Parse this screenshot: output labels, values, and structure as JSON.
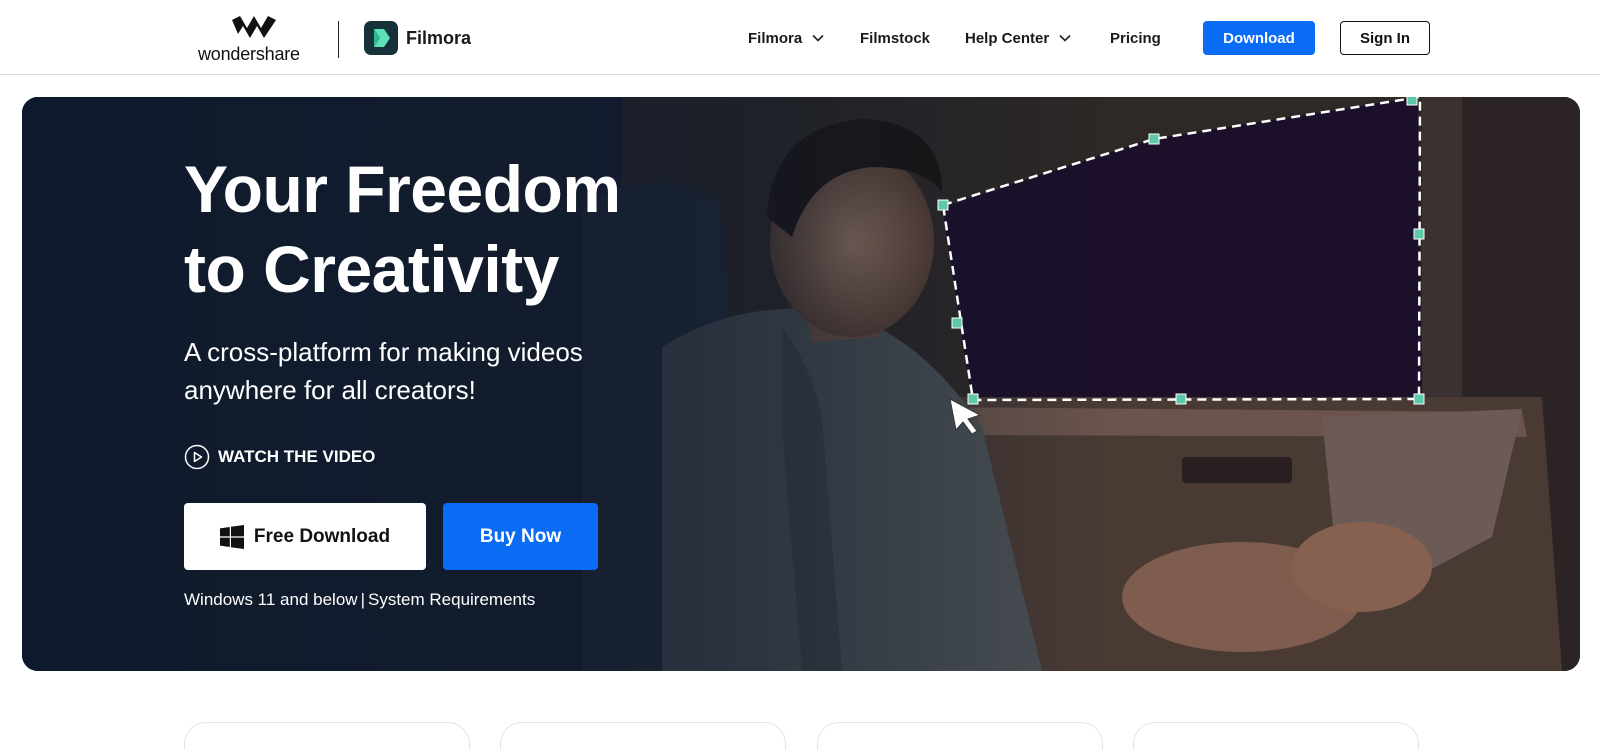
{
  "header": {
    "brand_name": "wondershare",
    "product_name": "Filmora",
    "nav": {
      "filmora": "Filmora",
      "filmstock": "Filmstock",
      "help_center": "Help Center",
      "pricing": "Pricing"
    },
    "download_label": "Download",
    "signin_label": "Sign In"
  },
  "hero": {
    "title_line1": "Your Freedom",
    "title_line2": "to Creativity",
    "subtitle_line1": "A cross-platform for making videos",
    "subtitle_line2": "anywhere for all creators!",
    "watch_label": "WATCH THE VIDEO",
    "free_download_label": "Free Download",
    "buy_now_label": "Buy Now",
    "os_note": "Windows 11 and below",
    "separator": "|",
    "system_requirements": "System Requirements"
  },
  "colors": {
    "accent": "#0a6cf5",
    "selection_handle": "#5ec8a8",
    "hero_dark": "#0f1b2d"
  },
  "icons": [
    "wondershare-logo-icon",
    "filmora-logo-icon",
    "chevron-down-icon",
    "play-circle-icon",
    "windows-icon",
    "mouse-cursor-icon"
  ]
}
